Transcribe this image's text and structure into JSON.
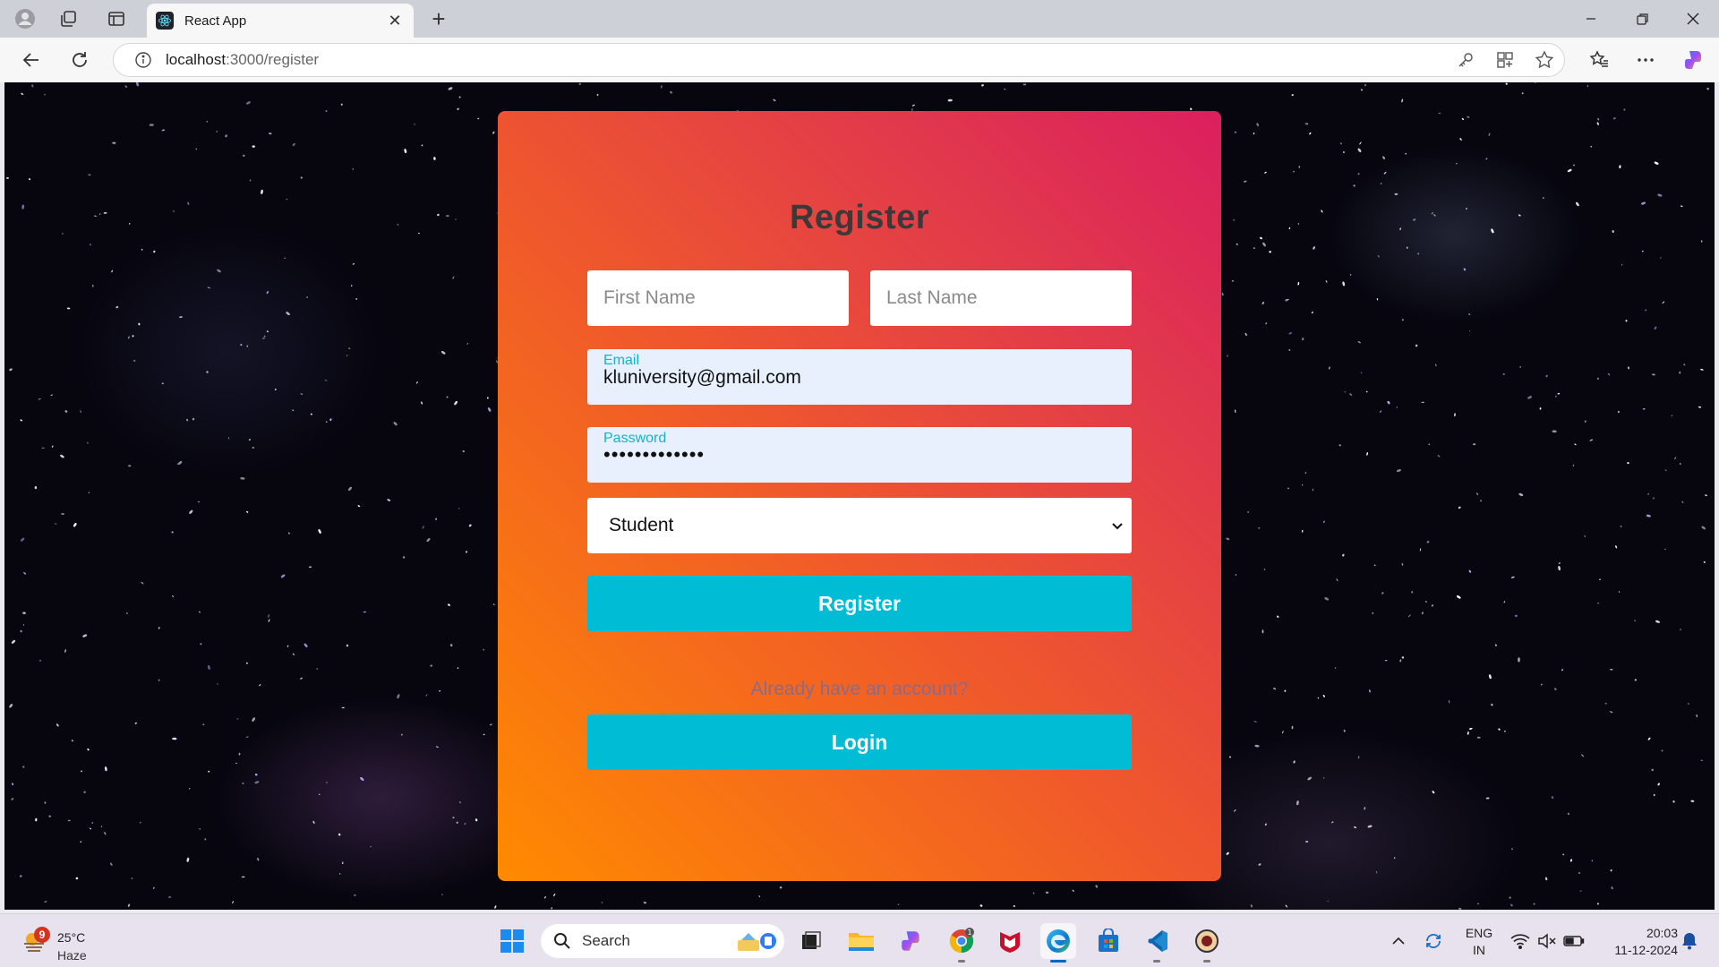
{
  "browser": {
    "tab_title": "React App",
    "url_host": "localhost",
    "url_path": ":3000/register",
    "new_tab_label": "+",
    "close_tab_label": "✕"
  },
  "form": {
    "title": "Register",
    "first_name_placeholder": "First Name",
    "last_name_placeholder": "Last Name",
    "email_label": "Email",
    "email_value": "kluniversity@gmail.com",
    "password_label": "Password",
    "password_value": "•••••••••••••",
    "role_selected": "Student",
    "register_button": "Register",
    "already_text": "Already have an account?",
    "login_button": "Login"
  },
  "taskbar": {
    "weather_badge": "9",
    "weather_temp": "25°C",
    "weather_condition": "Haze",
    "search_label": "Search",
    "lang_line1": "ENG",
    "lang_line2": "IN",
    "time": "20:03",
    "date": "11-12-2024"
  },
  "colors": {
    "card_gradient_start": "#ff8a00",
    "card_gradient_end": "#db1f5e",
    "button": "#00bcd4",
    "autofill_bg": "#e8f0fe",
    "field_label": "#12b3cc"
  }
}
